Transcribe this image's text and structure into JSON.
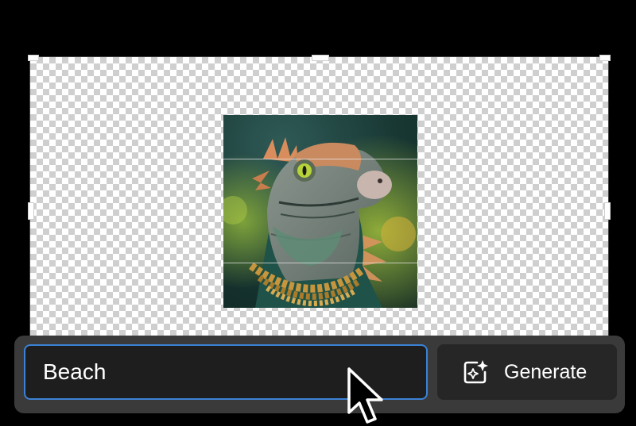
{
  "canvas": {
    "background": "transparent-checkerboard",
    "artwork": {
      "subject": "iguana-portrait",
      "colors": {
        "background": "#183733",
        "scales": "#6e7f78",
        "crest": "#d98d5c",
        "eye": "#b7d33a",
        "necklace": "#c5963d"
      }
    }
  },
  "prompt_bar": {
    "input_value": "Beach",
    "generate_label": "Generate",
    "generate_icon": "sparkle-image-icon",
    "accent": "#3b82d6"
  },
  "cursor": {
    "icon": "arrow-cursor-icon"
  }
}
